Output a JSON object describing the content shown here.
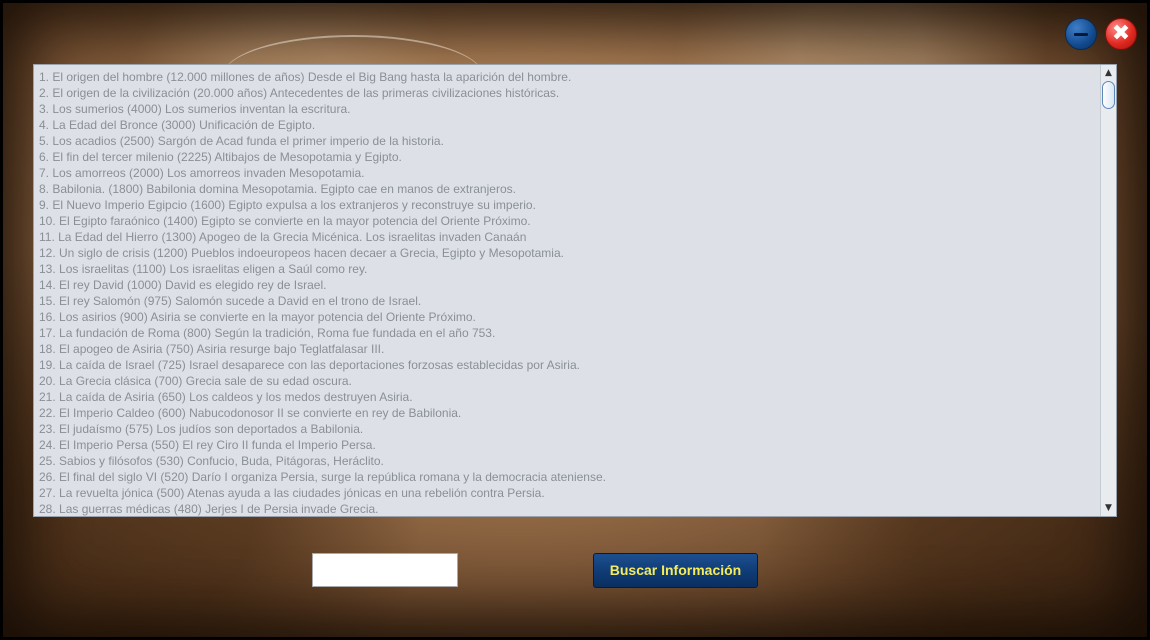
{
  "window": {
    "minimize_icon": "minimize-icon",
    "close_icon": "close-icon",
    "close_glyph": "✖"
  },
  "list": {
    "items": [
      "1. El origen del hombre  (12.000 millones de años) Desde el Big Bang hasta la aparición del hombre.",
      "2. El origen de la civilización (20.000 años) Antecedentes de las primeras civilizaciones históricas.",
      "3. Los sumerios (4000) Los sumerios inventan la escritura.",
      "4. La Edad del Bronce (3000) Unificación de Egipto.",
      "5. Los acadios (2500) Sargón de Acad funda el primer imperio de la historia.",
      "6. El fin del tercer milenio (2225) Altibajos de Mesopotamia y Egipto.",
      "7. Los amorreos (2000) Los amorreos invaden Mesopotamia.",
      "8. Babilonia. (1800) Babilonia domina Mesopotamia. Egipto cae en manos de extranjeros.",
      "9. El Nuevo Imperio Egipcio (1600) Egipto expulsa a los extranjeros y reconstruye su imperio.",
      "10. El Egipto faraónico (1400) Egipto se convierte en la mayor potencia del Oriente Próximo.",
      "11. La Edad del Hierro (1300) Apogeo de la Grecia Micénica. Los israelitas invaden Canaán",
      "12. Un siglo de crisis (1200) Pueblos indoeuropeos hacen decaer a Grecia, Egipto y Mesopotamia.",
      "13. Los israelitas (1100) Los israelitas eligen a Saúl como rey.",
      "14. El rey David (1000) David es elegido rey de Israel.",
      "15. El rey Salomón  (975) Salomón sucede a David en el trono de Israel.",
      "16. Los asirios  (900) Asiria se convierte en la mayor potencia del Oriente Próximo.",
      "17. La fundación de Roma  (800) Según la tradición, Roma fue fundada en el año 753.",
      "18. El apogeo de Asiria  (750) Asiria resurge bajo Teglatfalasar III.",
      "19. La caída de Israel  (725) Israel desaparece con las deportaciones forzosas establecidas por Asiria.",
      "20. La Grecia clásica  (700) Grecia sale de su edad oscura.",
      "21. La caída de Asiria  (650) Los caldeos y los medos destruyen Asiria.",
      "22. El Imperio Caldeo  (600) Nabucodonosor II se convierte en rey de Babilonia.",
      "23. El judaísmo  (575) Los judíos son deportados a Babilonia.",
      "24. El Imperio Persa (550) El rey Ciro II funda el Imperio Persa.",
      "25. Sabios y filósofos (530) Confucio, Buda, Pitágoras, Heráclito.",
      "26. El final del siglo VI (520) Darío I  organiza Persia, surge la república romana y la democracia ateniense.",
      "27. La revuelta jónica (500) Atenas ayuda a las ciudades jónicas en una rebelión contra Persia.",
      "28. Las guerras médicas (480) Jerjes I de Persia invade Grecia."
    ],
    "scroll_up_icon": "▲",
    "scroll_down_icon": "▼"
  },
  "search": {
    "value": "",
    "button_label": "Buscar Información"
  },
  "colors": {
    "list_text": "#8a8f97",
    "list_bg": "#dde1e7",
    "button_bg": "#0f3b75",
    "button_text": "#f6ec5b",
    "close_red": "#e02a22",
    "minimize_blue": "#124a8e"
  }
}
